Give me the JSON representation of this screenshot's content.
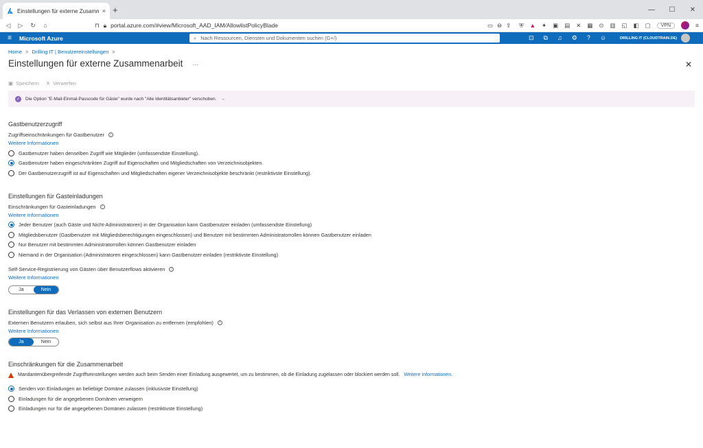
{
  "browser": {
    "tab_title": "Einstellungen für externe Zusammenarbeit",
    "url": "portal.azure.com/#view/Microsoft_AAD_IAM/AllowlistPolicyBlade",
    "vpn_label": "VPN",
    "new_tab": "+",
    "tab_close": "×"
  },
  "azure": {
    "brand": "Microsoft Azure",
    "search_placeholder": "Nach Ressourcen, Diensten und Dokumenten suchen (G+/)",
    "user": "DRILLING IT (CLOUDTRAIN.DE)"
  },
  "breadcrumb": {
    "items": [
      "Home",
      "Drilling IT | Benutzereinstellungen"
    ],
    "separator": ">"
  },
  "page": {
    "title": "Einstellungen für externe Zusammenarbeit",
    "more": "···"
  },
  "commands": {
    "save": "Speichern",
    "discard": "Verwerfen"
  },
  "message": "Die Option \"E-Mail-Einmal-Passcode für Gäste\" wurde nach \"Alle Identitätsanbieter\" verschoben.",
  "guest_access": {
    "heading": "Gastbenutzerzugriff",
    "label": "Zugriffseinschränkungen für Gastbenutzer",
    "more_info": "Weitere Informationen",
    "options": [
      "Gastbenutzer haben denselben Zugriff wie Mitglieder (umfassendste Einstellung).",
      "Gastbenutzer haben eingeschränkten Zugriff auf Eigenschaften und Mitgliedschaften von Verzeichnisobjekten.",
      "Der Gastbenutzerzugriff ist auf Eigenschaften und Mitgliedschaften eigener Verzeichnisobjekte beschränkt (restriktivste Einstellung)."
    ],
    "selected": 1
  },
  "guest_invite": {
    "heading": "Einstellungen für Gasteinladungen",
    "label": "Einschränkungen für Gasteinladungen",
    "more_info": "Weitere Informationen",
    "options": [
      "Jeder Benutzer (auch Gäste und Nicht-Administratoren) in der Organisation kann Gastbenutzer einladen (umfassendste Einstellung)",
      "Mitgliedsbenutzer (Gastbenutzer mit Mitgliedsberechtigungen eingeschlossen) und Benutzer mit bestimmten Administratorrollen können Gastbenutzer einladen",
      "Nur Benutzer mit bestimmten Administratorrollen können Gastbenutzer einladen",
      "Niemand in der Organisation (Administratoren eingeschlossen) kann Gastbenutzer einladen (restriktivste Einstellung)"
    ],
    "selected": 0,
    "self_service_label": "Self-Service-Registrierung von Gästen über Benutzerflows aktivieren",
    "self_service_more": "Weitere Informationen",
    "toggle_yes": "Ja",
    "toggle_no": "Nein",
    "self_service_value": "Nein"
  },
  "leave": {
    "heading": "Einstellungen für das Verlassen von externen Benutzern",
    "label": "Externen Benutzern erlauben, sich selbst aus Ihrer Organisation zu entfernen (empfohlen)",
    "more_info": "Weitere Informationen",
    "toggle_yes": "Ja",
    "toggle_no": "Nein",
    "value": "Ja"
  },
  "collab": {
    "heading": "Einschränkungen für die Zusammenarbeit",
    "warning": "Mandantenübergreifende Zugriffseinstellungen werden auch beim Senden einer Einladung ausgewertet, um zu bestimmen, ob die Einladung zugelassen oder blockiert werden soll.",
    "warning_link": "Weitere Informationen.",
    "options": [
      "Senden von Einladungen an beliebige Domäne zulassen (inklusivste Einstellung)",
      "Einladungen für die angegebenen Domänen verweigern",
      "Einladungen nur für die angegebenen Domänen zulassen (restriktivste Einstellung)"
    ],
    "selected": 0
  },
  "colors": {
    "accent": "#0f6cbd",
    "message_bg": "#f7f0f7",
    "warning": "#d83b01"
  }
}
